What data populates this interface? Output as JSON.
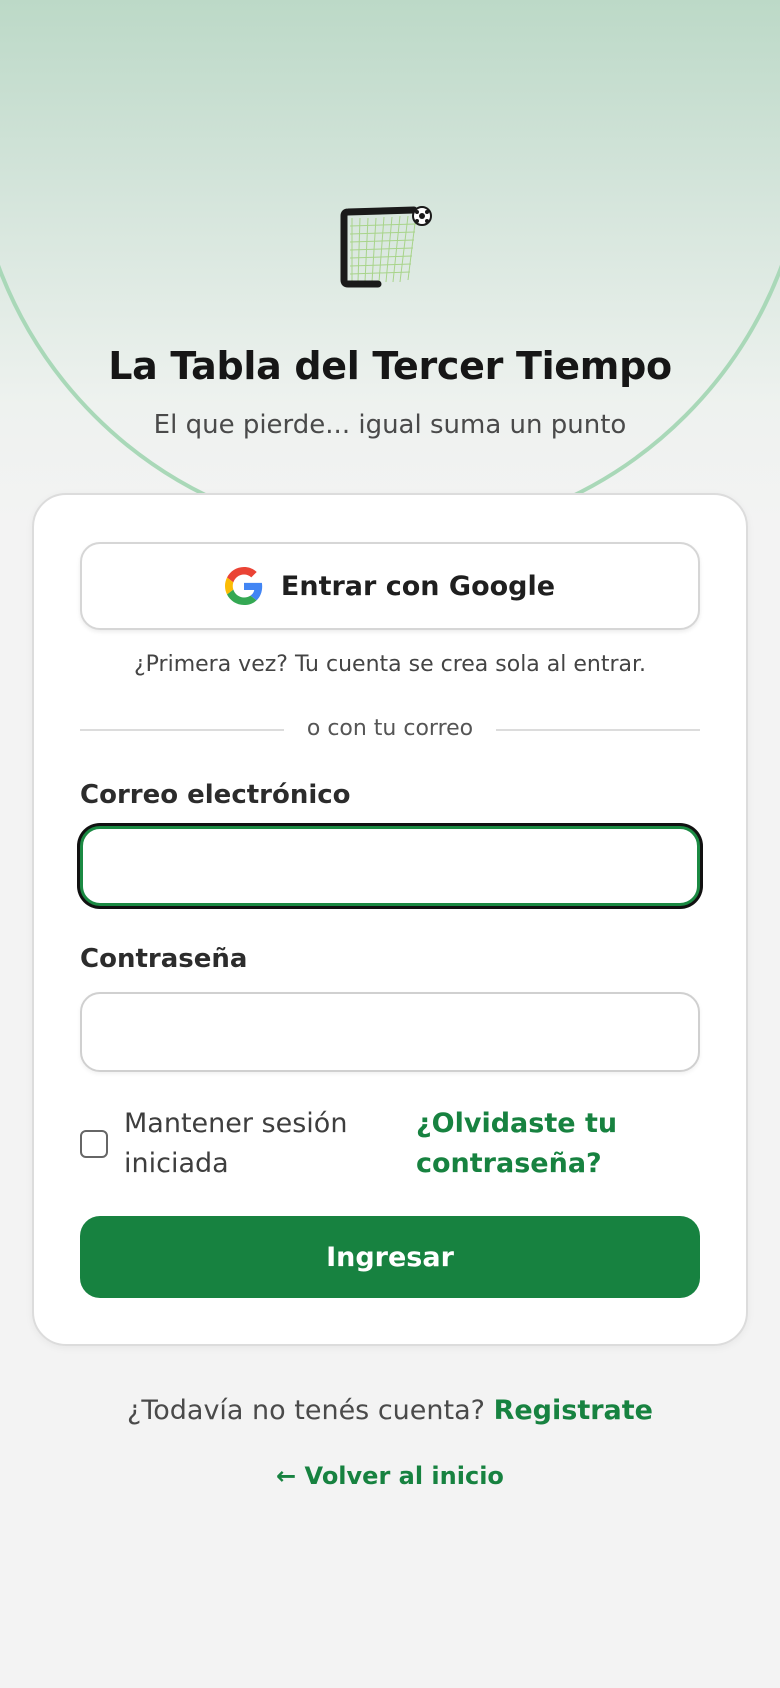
{
  "brand": {
    "title": "La Tabla del Tercer Tiempo",
    "subtitle": "El que pierde... igual suma un punto",
    "logo_icon": "soccer-goal-icon"
  },
  "auth": {
    "google_button_label": "Entrar con Google",
    "google_icon": "google-g-icon",
    "first_time_hint": "¿Primera vez? Tu cuenta se crea sola al entrar.",
    "divider_text": "o con tu correo",
    "email_label": "Correo electrónico",
    "email_value": "",
    "password_label": "Contraseña",
    "password_value": "",
    "remember_label": "Mantener sesión iniciada",
    "remember_checked": false,
    "forgot_link": "¿Olvidaste tu contraseña?",
    "submit_label": "Ingresar"
  },
  "footer": {
    "no_account_text": "¿Todavía no tenés cuenta?",
    "register_link": "Registrate",
    "back_link": "← Volver al inicio"
  },
  "colors": {
    "accent": "#178240",
    "focus_border": "#1b8a43",
    "background": "#f3f3f3",
    "header_gradient_top": "#bcd9c7"
  }
}
